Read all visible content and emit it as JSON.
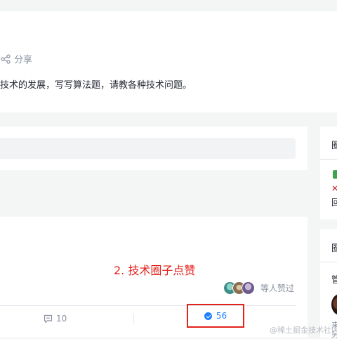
{
  "header": {
    "share_label": "分享",
    "description": "技术的发展，写写算法题，请教各种技术问题。"
  },
  "post": {
    "annotation": "2. 技术圈子点赞",
    "likers_text": "等人赞过",
    "comment_count": "10",
    "like_count": "56"
  },
  "sidebar": {
    "card1_title": "圈",
    "card1_line3": "回",
    "card2_title": "圈",
    "card2_heading": "管",
    "card2_text": "来\n另"
  },
  "watermark": "@稀土掘金技术社区",
  "colors": {
    "accent": "#1e80ff",
    "annotation": "#e4211b"
  }
}
